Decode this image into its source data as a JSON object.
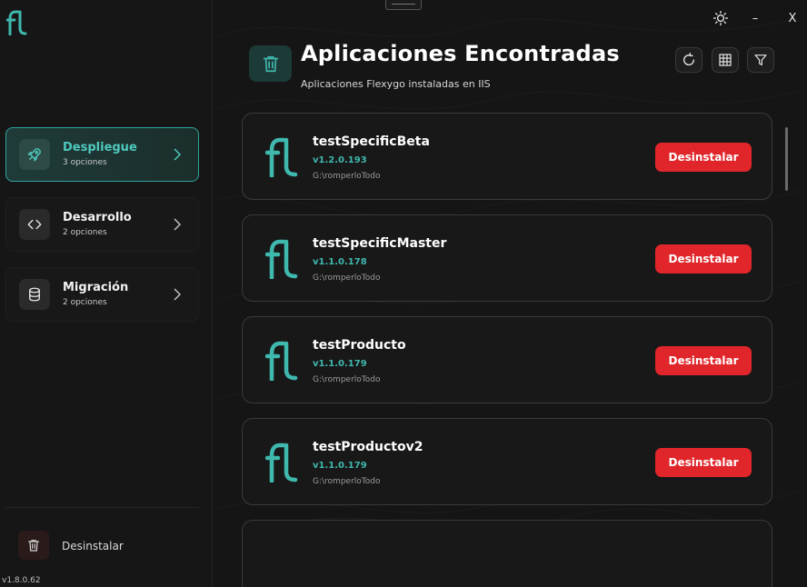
{
  "app": {
    "version": "v1.8.0.62"
  },
  "sidebar": {
    "items": [
      {
        "label": "Despliegue",
        "sub": "3 opciones",
        "icon": "rocket-icon",
        "active": true
      },
      {
        "label": "Desarrollo",
        "sub": "2 opciones",
        "icon": "code-icon",
        "active": false
      },
      {
        "label": "Migración",
        "sub": "2 opciones",
        "icon": "database-icon",
        "active": false
      }
    ],
    "uninstall_label": "Desinstalar"
  },
  "window": {
    "close_label": "X",
    "minimize_label": "–"
  },
  "header": {
    "title": "Aplicaciones Encontradas",
    "subtitle": "Aplicaciones Flexygo instaladas en IIS"
  },
  "apps": [
    {
      "name": "testSpecificBeta",
      "version": "v1.2.0.193",
      "path": "G:\\romperloTodo",
      "action": "Desinstalar"
    },
    {
      "name": "testSpecificMaster",
      "version": "v1.1.0.178",
      "path": "G:\\romperloTodo",
      "action": "Desinstalar"
    },
    {
      "name": "testProducto",
      "version": "v1.1.0.179",
      "path": "G:\\romperloTodo",
      "action": "Desinstalar"
    },
    {
      "name": "testProductov2",
      "version": "v1.1.0.179",
      "path": "G:\\romperloTodo",
      "action": "Desinstalar"
    }
  ],
  "colors": {
    "accent": "#3fb8ad",
    "danger": "#e0262b",
    "background": "#151515"
  }
}
